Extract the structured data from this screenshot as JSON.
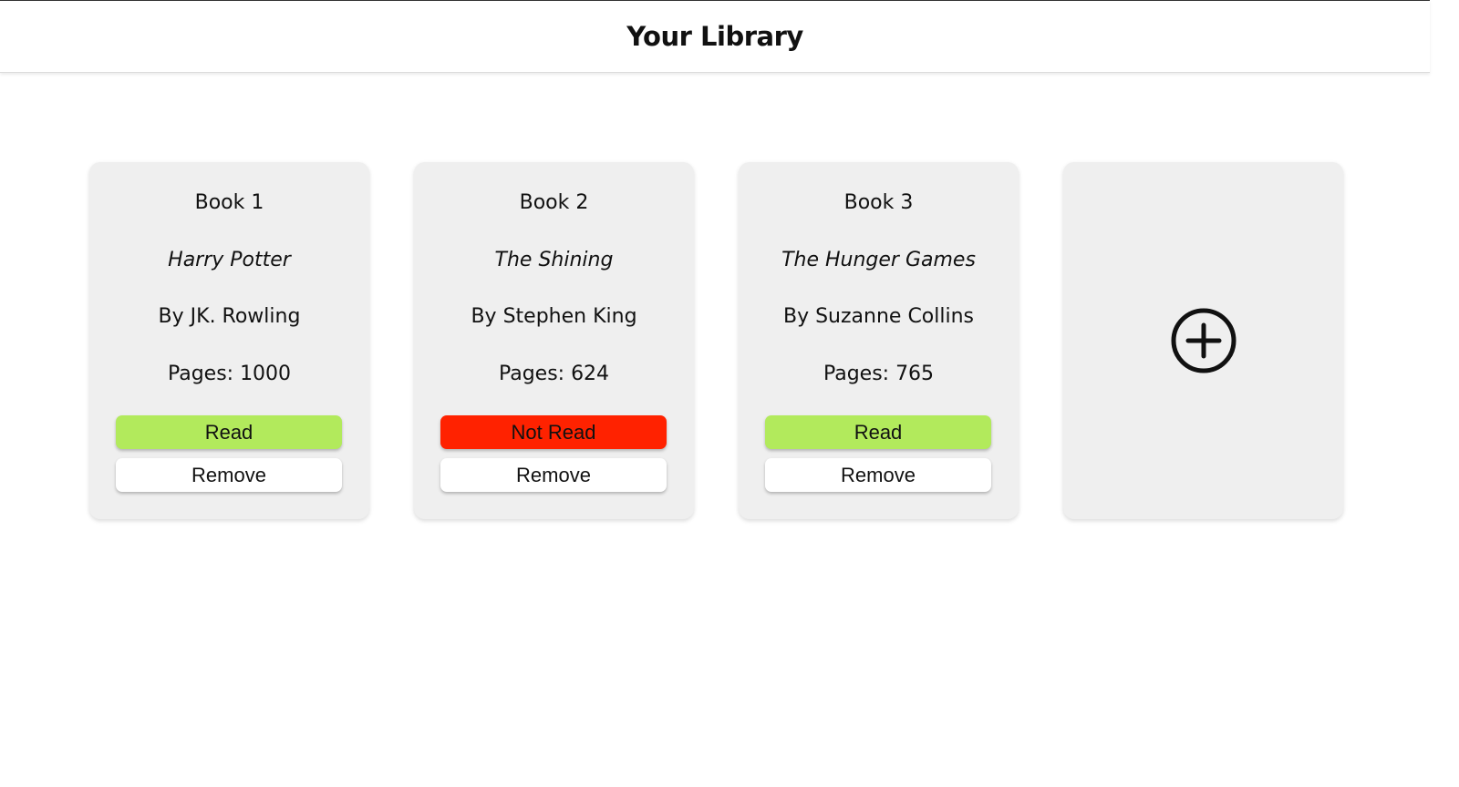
{
  "header": {
    "title": "Your Library"
  },
  "books": [
    {
      "number": "Book 1",
      "title": "Harry Potter",
      "author": "By JK. Rowling",
      "pages": "Pages: 1000",
      "status_label": "Read",
      "status": "read",
      "remove_label": "Remove"
    },
    {
      "number": "Book 2",
      "title": "The Shining",
      "author": "By Stephen King",
      "pages": "Pages: 624",
      "status_label": "Not Read",
      "status": "not-read",
      "remove_label": "Remove"
    },
    {
      "number": "Book 3",
      "title": "The Hunger Games",
      "author": "By Suzanne Collins",
      "pages": "Pages: 765",
      "status_label": "Read",
      "status": "read",
      "remove_label": "Remove"
    }
  ],
  "add_card": {
    "icon": "plus-circle-icon"
  },
  "colors": {
    "read": "#b2ea5c",
    "not_read": "#ff2200",
    "card_bg": "#efefef"
  }
}
